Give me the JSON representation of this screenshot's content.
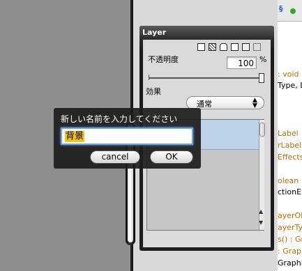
{
  "layer_panel": {
    "title": "Layer",
    "toolbar_icons": [
      "new-layer-icon",
      "duplicate-layer-icon",
      "lock-icon",
      "new-page-icon",
      "folder-icon",
      "trash-icon"
    ],
    "opacity_label": "不透明度",
    "opacity_value": "100",
    "opacity_unit": "%",
    "opacity_slider_level": 1.0,
    "effect_label": "効果",
    "effect_value": "通常"
  },
  "dialog": {
    "prompt": "新しい名前を入力してください",
    "input_value": "背景",
    "cancel_label": "cancel",
    "ok_label": "OK"
  },
  "code_editor": {
    "toolbar_icons": [
      "s-icon",
      "status-dot-icon"
    ],
    "lines": [
      ": void",
      "Type, La",
      "Label",
      "rLabel",
      "Effects",
      "olean",
      "ctionEv",
      "ayerOb",
      "ayerTyp",
      "s() : Gra",
      ": Graph",
      "Graphics"
    ]
  },
  "colors": {
    "dialog_input_highlight": "#f3c316",
    "selected_row": "#bcd3ea",
    "code_keyword": "#c56a00"
  }
}
